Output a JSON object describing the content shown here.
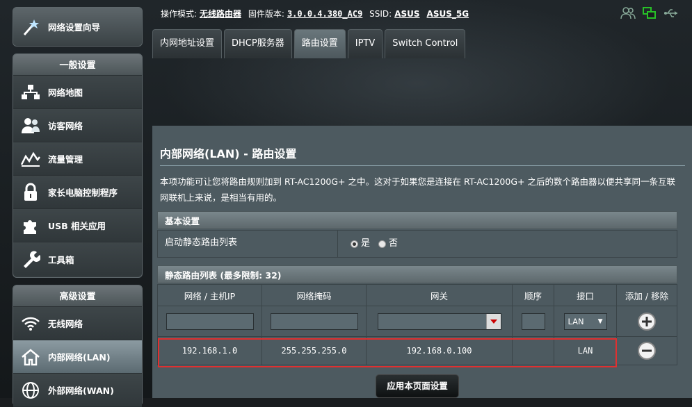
{
  "status_bar": {
    "mode_label": "操作模式:",
    "mode_value": "无线路由器",
    "fw_label": "固件版本:",
    "fw_value": "3.0.0.4.380_AC9",
    "ssid_label": "SSID:",
    "ssid_1": "ASUS",
    "ssid_2": "ASUS_5G",
    "icons": [
      "users-icon",
      "network-status-icon",
      "usb-icon"
    ]
  },
  "sidebar": {
    "wizard_label": "网络设置向导",
    "general_title": "一般设置",
    "general_items": [
      {
        "label": "网络地图",
        "icon": "network-map-icon"
      },
      {
        "label": "访客网络",
        "icon": "guest-network-icon"
      },
      {
        "label": "流量管理",
        "icon": "traffic-manager-icon"
      },
      {
        "label": "家长电脑控制程序",
        "icon": "parental-lock-icon"
      },
      {
        "label": "USB 相关应用",
        "icon": "puzzle-icon"
      },
      {
        "label": "工具箱",
        "icon": "wrench-icon"
      }
    ],
    "advanced_title": "高级设置",
    "advanced_items": [
      {
        "label": "无线网络",
        "icon": "wifi-icon"
      },
      {
        "label": "内部网络(LAN)",
        "icon": "home-icon",
        "active": true
      },
      {
        "label": "外部网络(WAN)",
        "icon": "globe-icon"
      }
    ]
  },
  "tabs": [
    {
      "label": "内网地址设置"
    },
    {
      "label": "DHCP服务器"
    },
    {
      "label": "路由设置",
      "active": true
    },
    {
      "label": "IPTV"
    },
    {
      "label": "Switch Control"
    }
  ],
  "main": {
    "title": "内部网络(LAN) - 路由设置",
    "description": "本项功能可让您将路由规则加到 RT-AC1200G+ 之中。这对于如果您是连接在 RT-AC1200G+ 之后的数个路由器以便共享同一条互联网联机上来说，是相当有用的。",
    "basic_section_title": "基本设置",
    "enable_static_label": "启动静态路由列表",
    "radio_yes": "是",
    "radio_no": "否",
    "radio_selected": "yes",
    "list_section_title": "静态路由列表 (最多限制:  32)",
    "columns": [
      "网络 / 主机IP",
      "网络掩码",
      "网关",
      "顺序",
      "接口",
      "添加 / 移除"
    ],
    "new_row": {
      "iface": "LAN"
    },
    "rows": [
      {
        "ip": "192.168.1.0",
        "mask": "255.255.255.0",
        "gateway": "192.168.0.100",
        "metric": "",
        "iface": "LAN"
      }
    ],
    "apply_label": "应用本页面设置"
  },
  "colors": {
    "background": "#1a1d1f",
    "content_bg": "#4d5a60",
    "highlight": "#e03030",
    "active_icon": "#27c127"
  }
}
